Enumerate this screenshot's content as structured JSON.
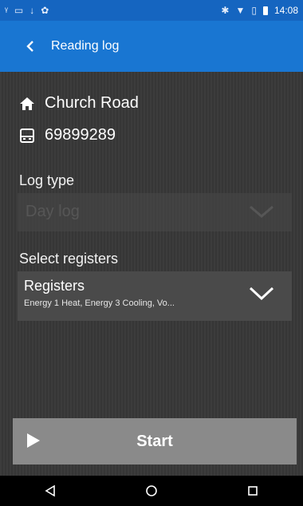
{
  "status_bar": {
    "time": "14:08",
    "icons": [
      "signal-icon",
      "screen-icon",
      "download-icon",
      "sync-icon",
      "bluetooth-icon",
      "wifi-icon",
      "sim-icon",
      "battery-icon"
    ]
  },
  "app_bar": {
    "title": "Reading log",
    "back_icon": "chevron-left-icon",
    "accent": "#1976d2"
  },
  "location": {
    "name": "Church Road",
    "icon": "home-icon"
  },
  "meter": {
    "id": "69899289",
    "icon": "meter-icon"
  },
  "log_type": {
    "label": "Log type",
    "value": "Day log",
    "disabled": true
  },
  "registers": {
    "label": "Select registers",
    "title": "Registers",
    "summary": "Energy 1 Heat, Energy 3 Cooling, Vo..."
  },
  "start_button": {
    "label": "Start",
    "icon": "play-icon"
  },
  "nav_bar": {
    "back_icon": "nav-back-icon",
    "home_icon": "nav-home-icon",
    "recents_icon": "nav-recents-icon"
  }
}
